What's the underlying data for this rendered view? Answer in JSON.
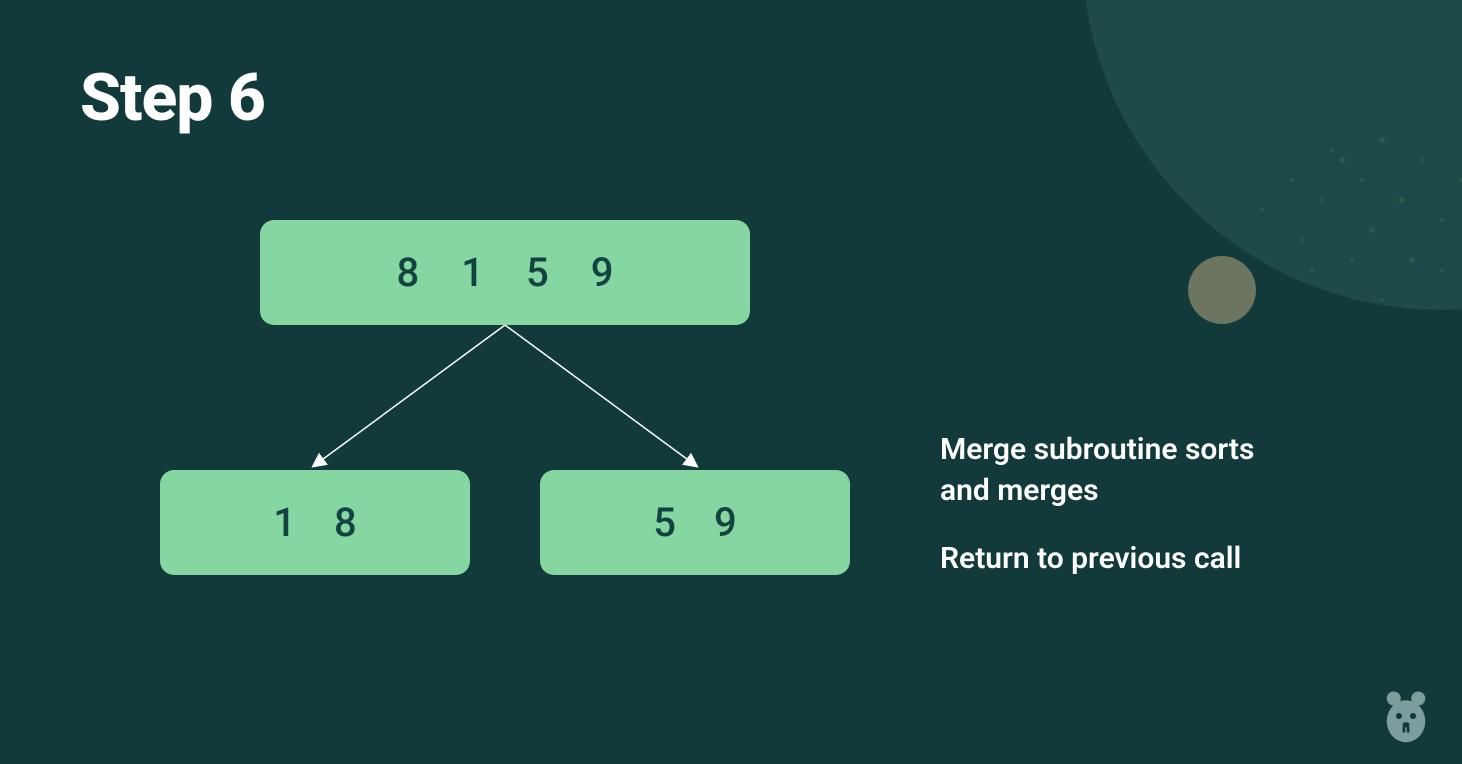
{
  "title": "Step 6",
  "tree": {
    "top": [
      "8",
      "1",
      "5",
      "9"
    ],
    "left": [
      "1",
      "8"
    ],
    "right": [
      "5",
      "9"
    ]
  },
  "sidebar": {
    "line1": "Merge subroutine sorts and merges",
    "line2": "Return to previous call"
  },
  "colors": {
    "bg": "#133a3a",
    "box": "#85d6a0",
    "boxText": "#134242",
    "text": "#ffffff"
  }
}
